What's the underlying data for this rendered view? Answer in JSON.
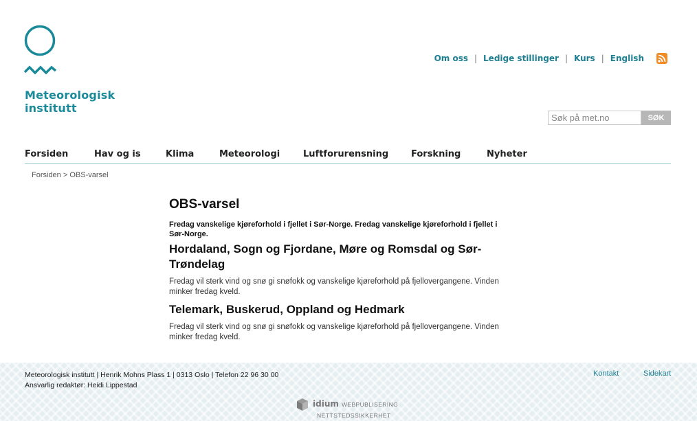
{
  "header": {
    "logo_line1": "Meteorologisk",
    "logo_line2": "institutt",
    "logo_icon": "circle-wave-logo",
    "top_links": [
      "Om oss",
      "Ledige stillinger",
      "Kurs",
      "English"
    ],
    "top_separator": "|",
    "rss_icon": "rss-icon"
  },
  "search": {
    "placeholder": "Søk på met.no",
    "button_label": "SØK"
  },
  "nav": {
    "items": [
      "Forsiden",
      "Hav og is",
      "Klima",
      "Meteorologi",
      "Luftforurensning",
      "Forskning",
      "Nyheter"
    ]
  },
  "breadcrumb": "Forsiden > OBS-varsel",
  "main": {
    "title": "OBS-varsel",
    "lead": "Fredag vanskelige kjøreforhold i fjellet i Sør-Norge. Fredag vanskelige kjøreforhold i fjellet i Sør-Norge.",
    "sections": [
      {
        "heading": "Hordaland, Sogn og Fjordane, Møre og Romsdal og Sør-Trøndelag",
        "text": "Fredag vil sterk vind og snø gi snøfokk og vanskelige kjøreforhold på fjellovergangene. Vinden minker fredag kveld."
      },
      {
        "heading": "Telemark, Buskerud, Oppland og Hedmark",
        "text": "Fredag vil sterk vind og snø gi snøfokk og vanskelige kjøreforhold på fjellovergangene. Vinden minker fredag kveld."
      }
    ]
  },
  "footer": {
    "address": "Meteorologisk institutt | Henrik Mohns Plass 1 | 0313 Oslo | Telefon 22 96 30 00",
    "editor": "Ansvarlig redaktør: Heidi Lippestad",
    "links": [
      "Kontakt",
      "Sidekart"
    ],
    "credit_brand": "idium",
    "credit_line1": "WEBPUBLISERING",
    "credit_line2": "NETTSTEDSSIKKERHET"
  },
  "colors": {
    "brand": "#1a8a9a",
    "link": "#1e7f93",
    "rss": "#f08a24",
    "footer_bg": "#e5eef0"
  }
}
